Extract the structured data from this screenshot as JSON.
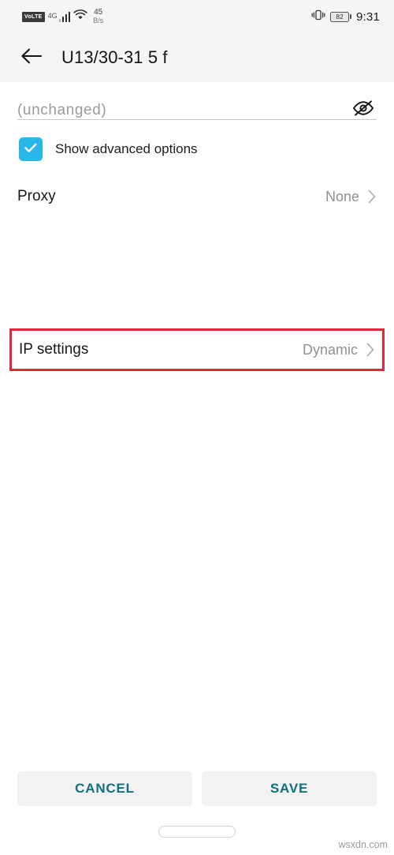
{
  "status_bar": {
    "carrier_badge": "VoLTE",
    "network_type": "4G",
    "data_rate_value": "45",
    "data_rate_unit": "B/s",
    "battery_level": "82",
    "time": "9:31",
    "icons": {
      "signal": "signal-bars-icon",
      "wifi": "wifi-icon",
      "vibrate": "vibrate-icon",
      "battery": "battery-icon"
    }
  },
  "app_bar": {
    "back_icon": "back-arrow-icon",
    "title": "U13/30-31 5 f"
  },
  "form": {
    "password_field": {
      "label": "password-field",
      "value": "",
      "placeholder": "(unchanged)",
      "toggle_icon": "eye-slash-icon"
    },
    "advanced_checkbox": {
      "label": "Show advanced options",
      "checked": true,
      "color": "#29b6e8"
    },
    "rows": [
      {
        "label": "Proxy",
        "value": "None",
        "chevron": "chevron-right-icon"
      },
      {
        "label": "IP settings",
        "value": "Dynamic",
        "chevron": "chevron-right-icon"
      }
    ]
  },
  "annotation": {
    "target": "IP settings",
    "border_color": "#e0283c"
  },
  "actions": {
    "cancel_label": "CANCEL",
    "save_label": "SAVE",
    "accent_color": "#11707e"
  },
  "footer": {
    "watermark": "wsxdn.com",
    "home_indicator": "home-indicator"
  }
}
